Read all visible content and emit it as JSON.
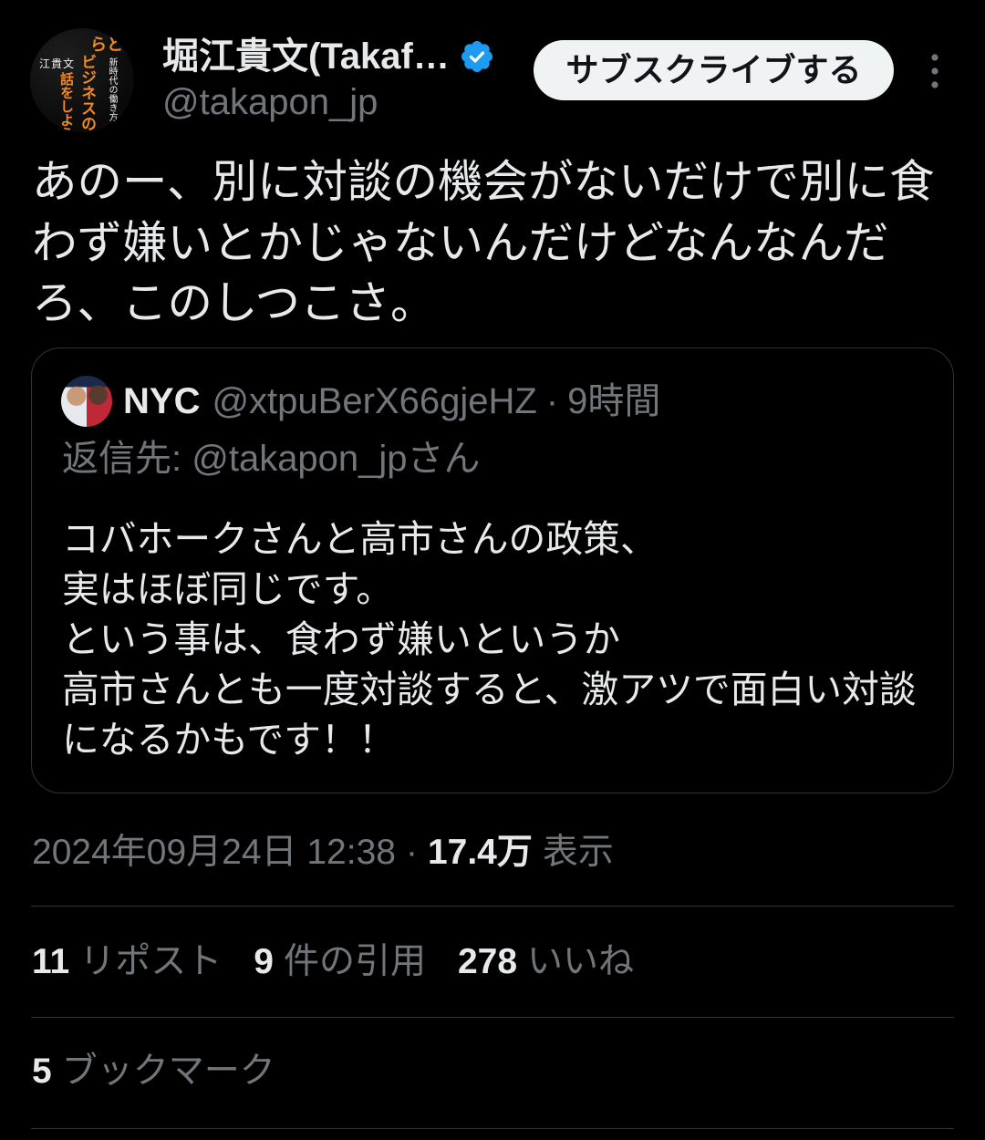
{
  "colors": {
    "background": "#000000",
    "text_primary": "#e7e9ea",
    "text_secondary": "#71767b",
    "border": "#2f3336",
    "verified_blue": "#1d9bf0",
    "button_bg": "#eff3f4",
    "button_text": "#0f1419",
    "avatar_accent": "#f08a24"
  },
  "author": {
    "name": "堀江貴文(Takaf…",
    "handle": "@takapon_jp",
    "verified_icon": "verified-badge-icon",
    "avatar": {
      "cover_text": {
        "top": "らと",
        "title_1": "ビジネスの",
        "title_2": "話をしよう",
        "subtitle": "新時代の働き方",
        "author": "江貴文"
      }
    }
  },
  "header": {
    "subscribe_label": "サブスクライブする",
    "more_icon": "more-vertical-icon"
  },
  "tweet": {
    "text": "あのー、別に対談の機会がないだけで別に食わず嫌いとかじゃないんだけどなんなんだろ、このしつこさ。"
  },
  "quote": {
    "name": "NYC",
    "handle": "@xtpuBerX66gjeHZ",
    "separator": "·",
    "time": "9時間",
    "reply_line": "返信先: @takapon_jpさん",
    "text": "コバホークさんと高市さんの政策、\n実はほぼ同じです。\nという事は、食わず嫌いというか\n高市さんとも一度対談すると、激アツで面白い対談になるかもです！！"
  },
  "meta": {
    "datetime": "2024年09月24日 12:38",
    "separator": "·",
    "views_count": "17.4万",
    "views_label": "表示"
  },
  "stats": {
    "reposts_count": "11",
    "reposts_label": "リポスト",
    "quotes_count": "9",
    "quotes_label": "件の引用",
    "likes_count": "278",
    "likes_label": "いいね"
  },
  "bookmarks": {
    "count": "5",
    "label": "ブックマーク"
  }
}
